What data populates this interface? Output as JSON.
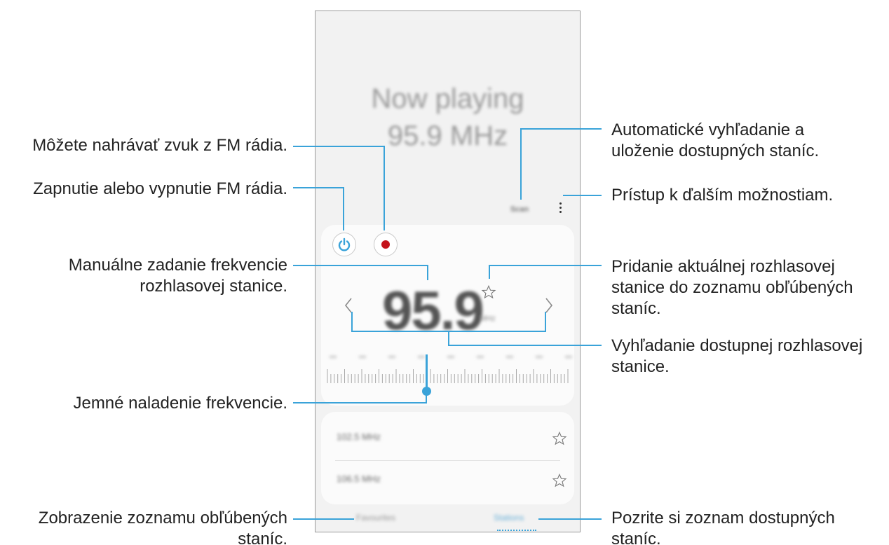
{
  "phone": {
    "now_playing_line1": "Now playing",
    "now_playing_line2": "95.9 MHz",
    "scan_label": "Scan",
    "frequency": "95.9",
    "frequency_unit": "MHz",
    "tuner_value_mhz": 95.9,
    "favorites": [
      {
        "label": "102.5 MHz"
      },
      {
        "label": "106.5 MHz"
      }
    ],
    "tab_favorites": "Favourites",
    "tab_all": "Stations",
    "accent_color": "#3aa3d9",
    "record_color": "#c4121a",
    "icons": [
      "power-icon",
      "record-icon",
      "more-options-icon",
      "chevron-left-icon",
      "chevron-right-icon",
      "star-outline-icon"
    ]
  },
  "callouts": {
    "record": "Môžete nahrávať zvuk z FM rádia.",
    "power": "Zapnutie alebo vypnutie FM rádia.",
    "manual_line1": "Manuálne zadanie frekvencie",
    "manual_line2": "rozhlasovej stanice.",
    "fine_tune": "Jemné naladenie frekvencie.",
    "favorites_line1": "Zobrazenie zoznamu obľúbených",
    "favorites_line2": "staníc.",
    "scan_line1": "Automatické vyhľadanie a",
    "scan_line2": "uloženie dostupných staníc.",
    "more": "Prístup k ďalším možnostiam.",
    "add_fav_line1": "Pridanie aktuálnej rozhlasovej",
    "add_fav_line2": "stanice do zoznamu obľúbených",
    "add_fav_line3": "staníc.",
    "search_line1": "Vyhľadanie dostupnej rozhlasovej",
    "search_line2": "stanice.",
    "list_line1": "Pozrite si zoznam dostupných",
    "list_line2": "staníc."
  }
}
